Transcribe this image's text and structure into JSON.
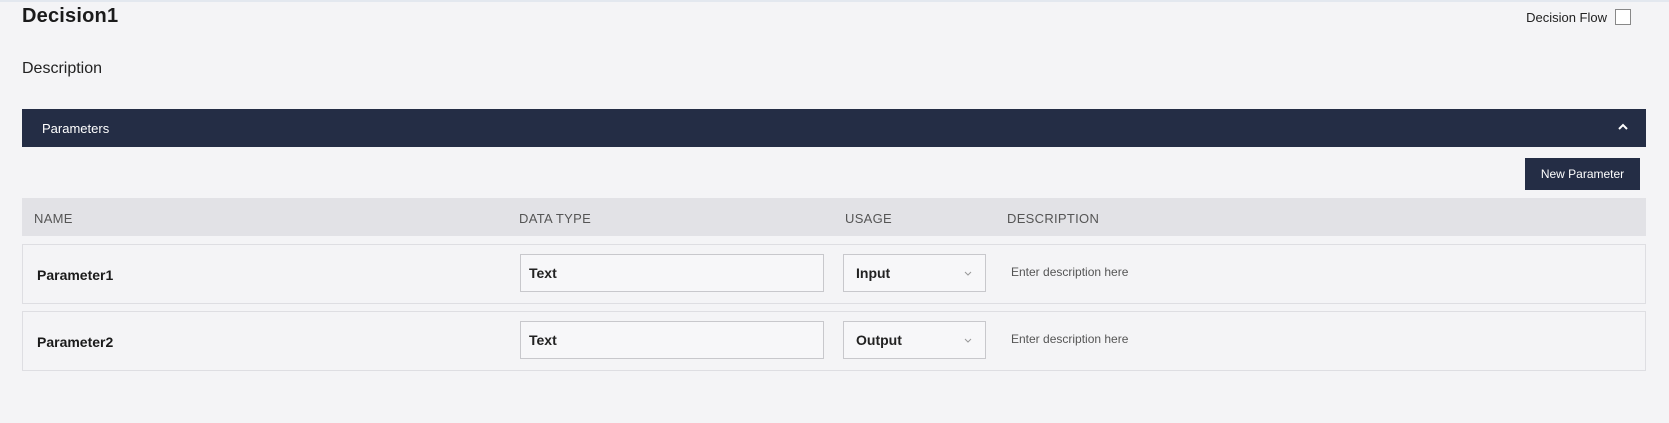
{
  "header": {
    "title": "Decision1",
    "decision_flow_label": "Decision Flow",
    "description_label": "Description"
  },
  "panel": {
    "title": "Parameters",
    "new_button": "New Parameter"
  },
  "table": {
    "columns": [
      "NAME",
      "DATA TYPE",
      "USAGE",
      "DESCRIPTION"
    ],
    "rows": [
      {
        "name": "Parameter1",
        "data_type": "Text",
        "usage": "Input",
        "description_placeholder": "Enter description here"
      },
      {
        "name": "Parameter2",
        "data_type": "Text",
        "usage": "Output",
        "description_placeholder": "Enter description here"
      }
    ]
  },
  "colors": {
    "header_bg": "#242d45",
    "table_head_bg": "#e2e2e6",
    "page_bg": "#f4f4f6"
  }
}
